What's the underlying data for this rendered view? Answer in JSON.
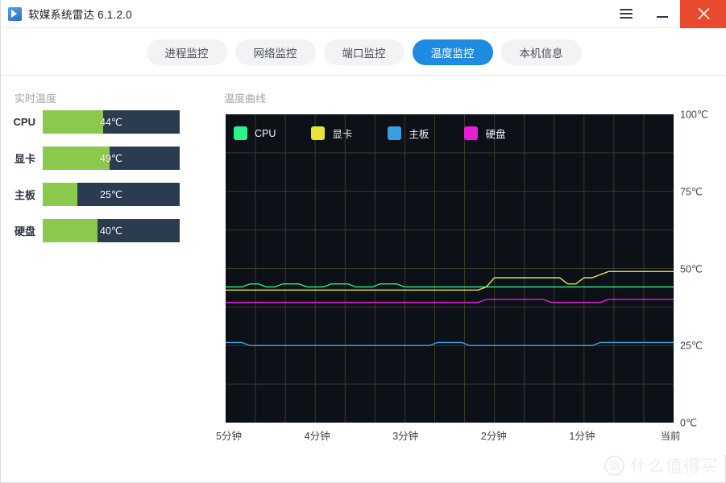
{
  "window": {
    "title": "软媒系统雷达 6.1.2.0",
    "icon": "radar-icon",
    "menu_label": "☰",
    "minimize_label": "–",
    "close_label": "✕"
  },
  "nav": {
    "tabs": [
      {
        "label": "进程监控",
        "active": false
      },
      {
        "label": "网络监控",
        "active": false
      },
      {
        "label": "端口监控",
        "active": false
      },
      {
        "label": "温度监控",
        "active": true
      },
      {
        "label": "本机信息",
        "active": false
      }
    ],
    "active_color": "#1e8ae0",
    "inactive_color": "#f1f3f5"
  },
  "left_panel": {
    "title": "实时温度",
    "bar_track_color": "#2b3c51",
    "bar_fill_color": "#8bc94e",
    "items": [
      {
        "name": "CPU",
        "value": "44℃",
        "percent": 44
      },
      {
        "name": "显卡",
        "value": "49℃",
        "percent": 49
      },
      {
        "name": "主板",
        "value": "25℃",
        "percent": 25
      },
      {
        "name": "硬盘",
        "value": "40℃",
        "percent": 40
      }
    ]
  },
  "right_panel": {
    "title": "温度曲线"
  },
  "watermark": {
    "badge": "值",
    "text": "什么值得买"
  },
  "chart_data": {
    "type": "line",
    "title": "温度曲线",
    "xlabel": "",
    "ylabel": "",
    "ylim": [
      0,
      100
    ],
    "yticks": [
      100,
      75,
      50,
      25,
      0
    ],
    "ytick_labels": [
      "100℃",
      "75℃",
      "50℃",
      "25℃",
      "0℃"
    ],
    "x_tick_labels": [
      "5分钟",
      "4分钟",
      "3分钟",
      "2分钟",
      "1分钟",
      "当前"
    ],
    "background": "#0c1017",
    "grid": true,
    "grid_color": "#3b3a2c",
    "legend_position": "top-left",
    "series": [
      {
        "name": "CPU",
        "color": "#2bf58a",
        "values": [
          44,
          44,
          44,
          45,
          45,
          44,
          44,
          45,
          45,
          45,
          44,
          44,
          44,
          45,
          45,
          45,
          44,
          44,
          44,
          45,
          45,
          45,
          44,
          44,
          44,
          44,
          44,
          44,
          44,
          44,
          44,
          44,
          44,
          44,
          44,
          44,
          44,
          44,
          44,
          44,
          44,
          44,
          44,
          44,
          44,
          44,
          44,
          44,
          44,
          44,
          44,
          44,
          44,
          44,
          44,
          44
        ]
      },
      {
        "name": "显卡",
        "color": "#e8e336",
        "values": [
          43,
          43,
          43,
          43,
          43,
          43,
          43,
          43,
          43,
          43,
          43,
          43,
          43,
          43,
          43,
          43,
          43,
          43,
          43,
          43,
          43,
          43,
          43,
          43,
          43,
          43,
          43,
          43,
          43,
          43,
          43,
          43,
          44,
          47,
          47,
          47,
          47,
          47,
          47,
          47,
          47,
          47,
          45,
          45,
          47,
          47,
          48,
          49,
          49,
          49,
          49,
          49,
          49,
          49,
          49,
          49
        ]
      },
      {
        "name": "主板",
        "color": "#3a9fe0",
        "values": [
          26,
          26,
          26,
          25,
          25,
          25,
          25,
          25,
          25,
          25,
          25,
          25,
          25,
          25,
          25,
          25,
          25,
          25,
          25,
          25,
          25,
          25,
          25,
          25,
          25,
          25,
          26,
          26,
          26,
          26,
          25,
          25,
          25,
          25,
          25,
          25,
          25,
          25,
          25,
          25,
          25,
          25,
          25,
          25,
          25,
          25,
          26,
          26,
          26,
          26,
          26,
          26,
          26,
          26,
          26,
          26
        ]
      },
      {
        "name": "硬盘",
        "color": "#e61fd6",
        "values": [
          39,
          39,
          39,
          39,
          39,
          39,
          39,
          39,
          39,
          39,
          39,
          39,
          39,
          39,
          39,
          39,
          39,
          39,
          39,
          39,
          39,
          39,
          39,
          39,
          39,
          39,
          39,
          39,
          39,
          39,
          39,
          39,
          40,
          40,
          40,
          40,
          40,
          40,
          40,
          40,
          39,
          39,
          39,
          39,
          39,
          39,
          39,
          40,
          40,
          40,
          40,
          40,
          40,
          40,
          40,
          40
        ]
      }
    ],
    "legend": [
      {
        "label": "CPU",
        "color": "#2bf58a"
      },
      {
        "label": "显卡",
        "color": "#e8e336"
      },
      {
        "label": "主板",
        "color": "#3a9fe0"
      },
      {
        "label": "硬盘",
        "color": "#e61fd6"
      }
    ]
  }
}
